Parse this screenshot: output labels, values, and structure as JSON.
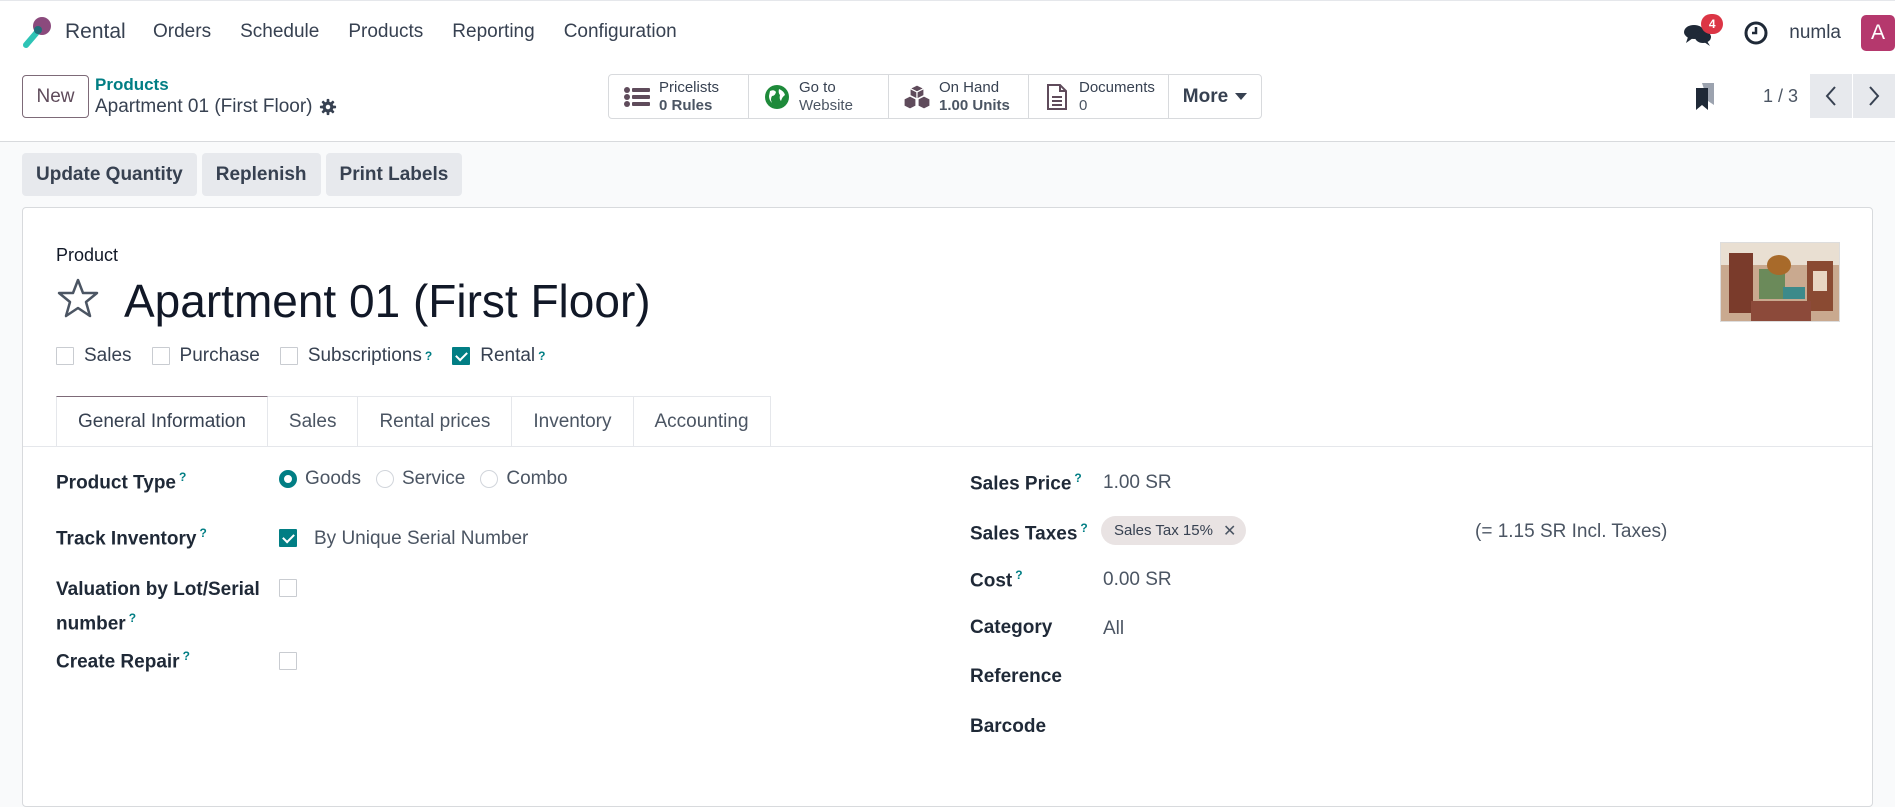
{
  "navbar": {
    "app_name": "Rental",
    "menu": [
      "Orders",
      "Schedule",
      "Products",
      "Reporting",
      "Configuration"
    ],
    "messages_badge": "4",
    "username": "numla",
    "avatar_letter": "A",
    "avatar_color": "#b5386d"
  },
  "control_panel": {
    "new_label": "New",
    "breadcrumb_parent": "Products",
    "breadcrumb_current": "Apartment 01 (First Floor)",
    "smart_buttons": [
      {
        "icon": "list-icon",
        "label": "Pricelists",
        "value": "0 Rules"
      },
      {
        "icon": "globe-icon",
        "label": "Go to",
        "value": "Website"
      },
      {
        "icon": "cubes-icon",
        "label": "On Hand",
        "value": "1.00 Units"
      },
      {
        "icon": "document-icon",
        "label": "Documents",
        "value": "0"
      }
    ],
    "more_label": "More",
    "pager": "1 / 3"
  },
  "actions": [
    "Update Quantity",
    "Replenish",
    "Print Labels"
  ],
  "form": {
    "product_label": "Product",
    "title": "Apartment 01 (First Floor)",
    "flags": [
      {
        "label": "Sales",
        "checked": false,
        "help": false
      },
      {
        "label": "Purchase",
        "checked": false,
        "help": false
      },
      {
        "label": "Subscriptions",
        "checked": false,
        "help": true
      },
      {
        "label": "Rental",
        "checked": true,
        "help": true
      }
    ],
    "tabs": [
      "General Information",
      "Sales",
      "Rental prices",
      "Inventory",
      "Accounting"
    ],
    "active_tab": "General Information",
    "left": {
      "product_type_label": "Product Type",
      "product_type_options": [
        "Goods",
        "Service",
        "Combo"
      ],
      "product_type_selected": "Goods",
      "track_inventory_label": "Track Inventory",
      "track_inventory_checked": true,
      "track_inventory_value": "By Unique Serial Number",
      "valuation_label_1": "Valuation by Lot/Serial",
      "valuation_label_2": "number",
      "valuation_checked": false,
      "create_repair_label": "Create Repair",
      "create_repair_checked": false
    },
    "right": {
      "sales_price_label": "Sales Price",
      "sales_price": "1.00 SR",
      "sales_taxes_label": "Sales Taxes",
      "sales_tax_tag": "Sales Tax 15%",
      "incl_taxes": "(= 1.15 SR Incl. Taxes)",
      "cost_label": "Cost",
      "cost": "0.00 SR",
      "category_label": "Category",
      "category": "All",
      "reference_label": "Reference",
      "reference": "",
      "barcode_label": "Barcode",
      "barcode": ""
    }
  },
  "help_mark": "?",
  "tag_remove": "✕"
}
